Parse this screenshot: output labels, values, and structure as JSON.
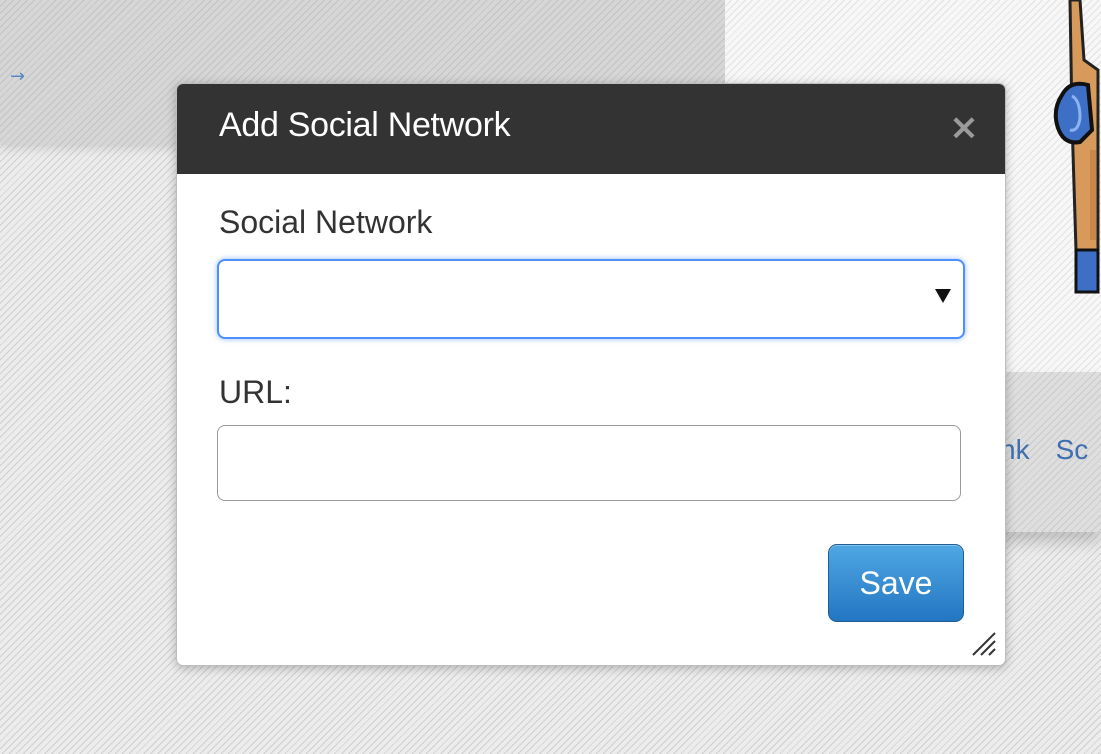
{
  "background": {
    "arrow_glyph": "→",
    "links": [
      "nk",
      "Sc"
    ]
  },
  "dialog": {
    "title": "Add Social Network",
    "close_glyph": "×",
    "social_network_label": "Social Network",
    "social_network_value": "",
    "url_label": "URL:",
    "url_value": "",
    "save_label": "Save",
    "icons": {
      "close": "close-icon",
      "dropdown": "dropdown-arrow-icon",
      "resize": "resize-grip-icon"
    },
    "colors": {
      "header_bg": "#333333",
      "focus_border": "#4d90fe",
      "primary_button": "#2a7fc6"
    }
  }
}
